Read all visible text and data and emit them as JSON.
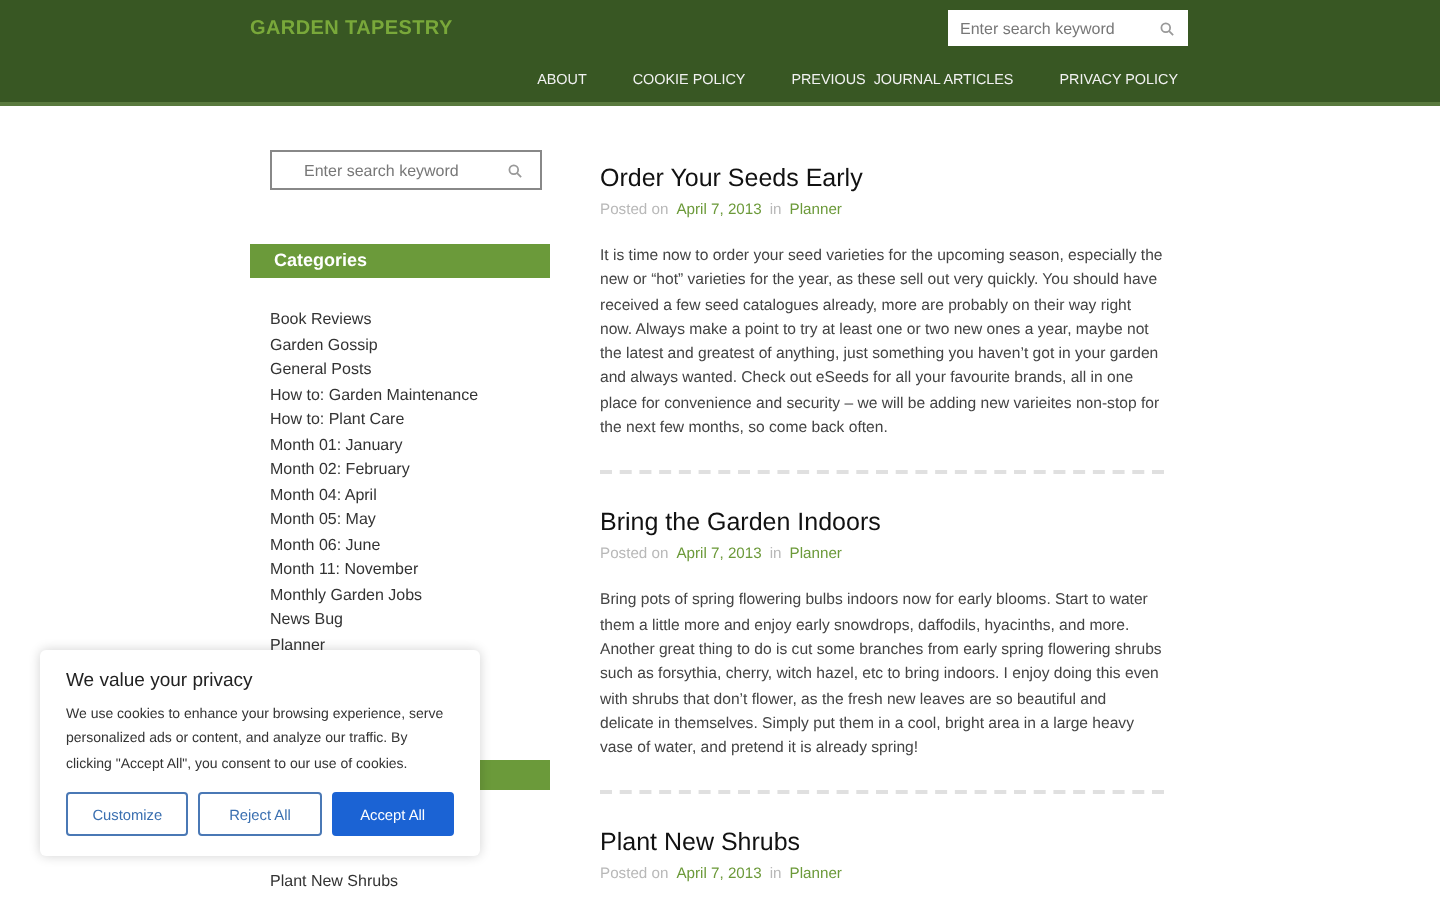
{
  "site": {
    "title": "GARDEN TAPESTRY"
  },
  "header_search": {
    "placeholder": "Enter search keyword"
  },
  "nav": [
    "ABOUT",
    "COOKIE POLICY",
    "PREVIOUS  JOURNAL ARTICLES",
    "PRIVACY POLICY"
  ],
  "sidebar": {
    "search": {
      "placeholder": "Enter search keyword"
    },
    "widgets": [
      {
        "title": "Categories",
        "items": [
          "Book Reviews",
          "Garden Gossip",
          "General Posts",
          "How to: Garden Maintenance",
          "How to: Plant Care",
          "Month 01: January",
          "Month 02: February",
          "Month 04: April",
          "Month 05: May",
          "Month 06: June",
          "Month 11: November",
          "Monthly Garden Jobs",
          "News Bug",
          "Planner"
        ]
      },
      {
        "items": [
          "Plant New Shrubs"
        ]
      }
    ]
  },
  "posts": [
    {
      "title": "Order Your Seeds Early",
      "posted_label": "Posted on",
      "date": "April 7, 2013",
      "in_label": "in",
      "category": "Planner",
      "body": "It is time now to order your seed varieties for the upcoming season, especially the new or “hot” varieties for the year, as these sell out very quickly. You should have received a few seed catalogues already, more are probably on their way right now. Always make a point to try at least one or two new ones a year, maybe not the latest and greatest of anything, just something you haven’t got in your garden and always wanted. Check out eSeeds for all your favourite brands, all in one place for convenience and security – we will be adding new varieites non-stop for the next few months, so come back often."
    },
    {
      "title": "Bring the Garden Indoors",
      "posted_label": "Posted on",
      "date": "April 7, 2013",
      "in_label": "in",
      "category": "Planner",
      "body": "Bring pots of spring flowering bulbs indoors now for early blooms. Start to water them a little more and enjoy early snowdrops, daffodils, hyacinths, and more. Another great thing to do is cut some branches from early spring flowering shrubs such as forsythia, cherry, witch hazel, etc to bring indoors. I enjoy doing this even with shrubs that don’t flower, as the fresh new leaves are so beautiful and delicate in themselves. Simply put them in a cool, bright area in a large heavy vase of water, and pretend it is already spring!"
    },
    {
      "title": "Plant New Shrubs",
      "posted_label": "Posted on",
      "date": "April 7, 2013",
      "in_label": "in",
      "category": "Planner"
    }
  ],
  "cookie_banner": {
    "title": "We value your privacy",
    "text": "We use cookies to enhance your browsing experience, serve personalized ads or content, and analyze our traffic. By clicking \"Accept All\", you consent to our use of cookies.",
    "buttons": [
      {
        "label": "Customize",
        "kind": "outline"
      },
      {
        "label": "Reject All",
        "kind": "outline"
      },
      {
        "label": "Accept All",
        "kind": "primary"
      }
    ]
  }
}
